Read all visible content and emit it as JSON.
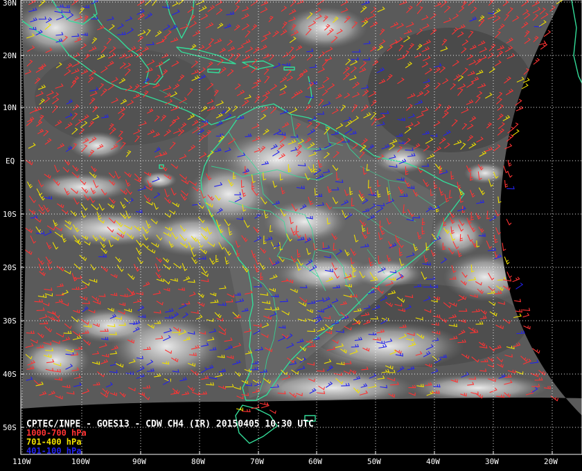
{
  "title": "CPTEC/INPE - GOES13 - CDW CH4 (IR) 20150405 10:30 UTC",
  "legend": [
    {
      "label": "1000-700 hPa",
      "color": "#ff3333"
    },
    {
      "label": "701-400 hPa",
      "color": "#f0e000"
    },
    {
      "label": "401-100 hPa",
      "color": "#2222ee"
    }
  ],
  "lat_labels": [
    "30N",
    "20N",
    "10N",
    "EQ",
    "10S",
    "20S",
    "30S",
    "40S",
    "50S"
  ],
  "lon_labels": [
    "110W",
    "100W",
    "90W",
    "80W",
    "70W",
    "60W",
    "50W",
    "40W",
    "30W",
    "20W"
  ],
  "colors": {
    "background": "#000000",
    "coastline": "#33dd99",
    "grid": "#ffffff"
  }
}
